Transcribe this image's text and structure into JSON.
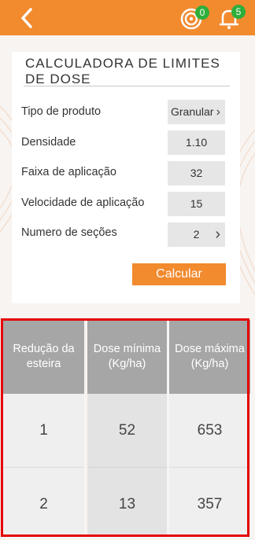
{
  "header": {
    "notifications_count_1": "0",
    "notifications_count_2": "5"
  },
  "card": {
    "title": "CALCULADORA DE LIMITES DE DOSE",
    "rows": [
      {
        "label": "Tipo de produto",
        "value": "Granular"
      },
      {
        "label": "Densidade",
        "value": "1.10"
      },
      {
        "label": "Faixa de aplicação",
        "value": "32"
      },
      {
        "label": "Velocidade de aplicação",
        "value": "15"
      },
      {
        "label": "Numero de seções",
        "value": "2"
      }
    ],
    "calc_label": "Calcular"
  },
  "table": {
    "headers": [
      "Redução da esteira",
      "Dose mínima (Kg/ha)",
      "Dose máxima (Kg/ha)"
    ],
    "rows": [
      [
        "1",
        "52",
        "653"
      ],
      [
        "2",
        "13",
        "357"
      ]
    ]
  },
  "colors": {
    "accent": "#f28a2e",
    "badge": "#2fae3c",
    "highlight": "#e60000",
    "header_cell": "#a6a6a6"
  }
}
